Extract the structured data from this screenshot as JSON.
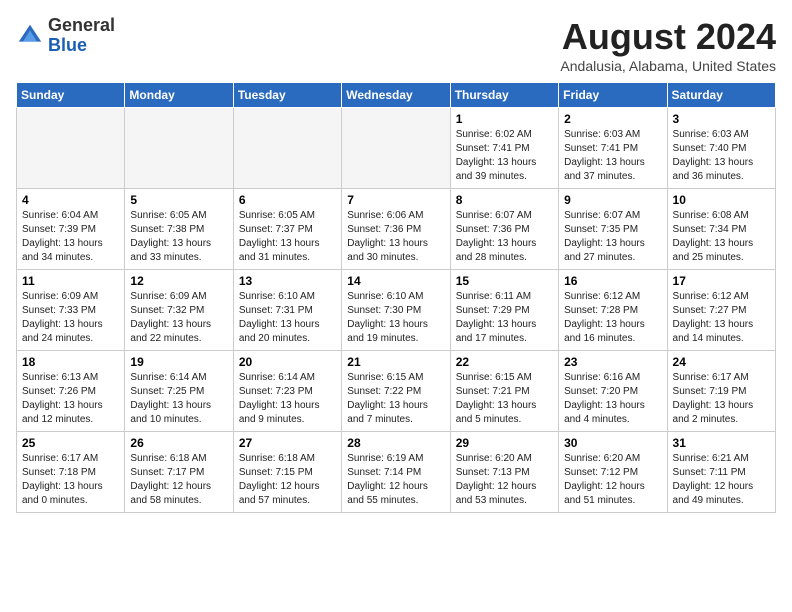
{
  "logo": {
    "general": "General",
    "blue": "Blue"
  },
  "header": {
    "month": "August 2024",
    "location": "Andalusia, Alabama, United States"
  },
  "weekdays": [
    "Sunday",
    "Monday",
    "Tuesday",
    "Wednesday",
    "Thursday",
    "Friday",
    "Saturday"
  ],
  "weeks": [
    [
      {
        "day": "",
        "info": "",
        "empty": true
      },
      {
        "day": "",
        "info": "",
        "empty": true
      },
      {
        "day": "",
        "info": "",
        "empty": true
      },
      {
        "day": "",
        "info": "",
        "empty": true
      },
      {
        "day": "1",
        "info": "Sunrise: 6:02 AM\nSunset: 7:41 PM\nDaylight: 13 hours\nand 39 minutes.",
        "empty": false
      },
      {
        "day": "2",
        "info": "Sunrise: 6:03 AM\nSunset: 7:41 PM\nDaylight: 13 hours\nand 37 minutes.",
        "empty": false
      },
      {
        "day": "3",
        "info": "Sunrise: 6:03 AM\nSunset: 7:40 PM\nDaylight: 13 hours\nand 36 minutes.",
        "empty": false
      }
    ],
    [
      {
        "day": "4",
        "info": "Sunrise: 6:04 AM\nSunset: 7:39 PM\nDaylight: 13 hours\nand 34 minutes.",
        "empty": false
      },
      {
        "day": "5",
        "info": "Sunrise: 6:05 AM\nSunset: 7:38 PM\nDaylight: 13 hours\nand 33 minutes.",
        "empty": false
      },
      {
        "day": "6",
        "info": "Sunrise: 6:05 AM\nSunset: 7:37 PM\nDaylight: 13 hours\nand 31 minutes.",
        "empty": false
      },
      {
        "day": "7",
        "info": "Sunrise: 6:06 AM\nSunset: 7:36 PM\nDaylight: 13 hours\nand 30 minutes.",
        "empty": false
      },
      {
        "day": "8",
        "info": "Sunrise: 6:07 AM\nSunset: 7:36 PM\nDaylight: 13 hours\nand 28 minutes.",
        "empty": false
      },
      {
        "day": "9",
        "info": "Sunrise: 6:07 AM\nSunset: 7:35 PM\nDaylight: 13 hours\nand 27 minutes.",
        "empty": false
      },
      {
        "day": "10",
        "info": "Sunrise: 6:08 AM\nSunset: 7:34 PM\nDaylight: 13 hours\nand 25 minutes.",
        "empty": false
      }
    ],
    [
      {
        "day": "11",
        "info": "Sunrise: 6:09 AM\nSunset: 7:33 PM\nDaylight: 13 hours\nand 24 minutes.",
        "empty": false
      },
      {
        "day": "12",
        "info": "Sunrise: 6:09 AM\nSunset: 7:32 PM\nDaylight: 13 hours\nand 22 minutes.",
        "empty": false
      },
      {
        "day": "13",
        "info": "Sunrise: 6:10 AM\nSunset: 7:31 PM\nDaylight: 13 hours\nand 20 minutes.",
        "empty": false
      },
      {
        "day": "14",
        "info": "Sunrise: 6:10 AM\nSunset: 7:30 PM\nDaylight: 13 hours\nand 19 minutes.",
        "empty": false
      },
      {
        "day": "15",
        "info": "Sunrise: 6:11 AM\nSunset: 7:29 PM\nDaylight: 13 hours\nand 17 minutes.",
        "empty": false
      },
      {
        "day": "16",
        "info": "Sunrise: 6:12 AM\nSunset: 7:28 PM\nDaylight: 13 hours\nand 16 minutes.",
        "empty": false
      },
      {
        "day": "17",
        "info": "Sunrise: 6:12 AM\nSunset: 7:27 PM\nDaylight: 13 hours\nand 14 minutes.",
        "empty": false
      }
    ],
    [
      {
        "day": "18",
        "info": "Sunrise: 6:13 AM\nSunset: 7:26 PM\nDaylight: 13 hours\nand 12 minutes.",
        "empty": false
      },
      {
        "day": "19",
        "info": "Sunrise: 6:14 AM\nSunset: 7:25 PM\nDaylight: 13 hours\nand 10 minutes.",
        "empty": false
      },
      {
        "day": "20",
        "info": "Sunrise: 6:14 AM\nSunset: 7:23 PM\nDaylight: 13 hours\nand 9 minutes.",
        "empty": false
      },
      {
        "day": "21",
        "info": "Sunrise: 6:15 AM\nSunset: 7:22 PM\nDaylight: 13 hours\nand 7 minutes.",
        "empty": false
      },
      {
        "day": "22",
        "info": "Sunrise: 6:15 AM\nSunset: 7:21 PM\nDaylight: 13 hours\nand 5 minutes.",
        "empty": false
      },
      {
        "day": "23",
        "info": "Sunrise: 6:16 AM\nSunset: 7:20 PM\nDaylight: 13 hours\nand 4 minutes.",
        "empty": false
      },
      {
        "day": "24",
        "info": "Sunrise: 6:17 AM\nSunset: 7:19 PM\nDaylight: 13 hours\nand 2 minutes.",
        "empty": false
      }
    ],
    [
      {
        "day": "25",
        "info": "Sunrise: 6:17 AM\nSunset: 7:18 PM\nDaylight: 13 hours\nand 0 minutes.",
        "empty": false
      },
      {
        "day": "26",
        "info": "Sunrise: 6:18 AM\nSunset: 7:17 PM\nDaylight: 12 hours\nand 58 minutes.",
        "empty": false
      },
      {
        "day": "27",
        "info": "Sunrise: 6:18 AM\nSunset: 7:15 PM\nDaylight: 12 hours\nand 57 minutes.",
        "empty": false
      },
      {
        "day": "28",
        "info": "Sunrise: 6:19 AM\nSunset: 7:14 PM\nDaylight: 12 hours\nand 55 minutes.",
        "empty": false
      },
      {
        "day": "29",
        "info": "Sunrise: 6:20 AM\nSunset: 7:13 PM\nDaylight: 12 hours\nand 53 minutes.",
        "empty": false
      },
      {
        "day": "30",
        "info": "Sunrise: 6:20 AM\nSunset: 7:12 PM\nDaylight: 12 hours\nand 51 minutes.",
        "empty": false
      },
      {
        "day": "31",
        "info": "Sunrise: 6:21 AM\nSunset: 7:11 PM\nDaylight: 12 hours\nand 49 minutes.",
        "empty": false
      }
    ]
  ]
}
